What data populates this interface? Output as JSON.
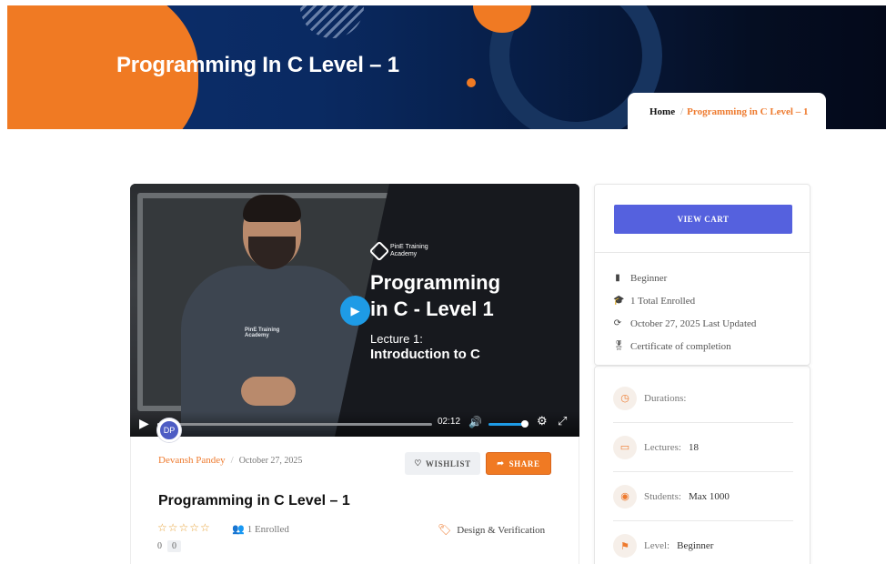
{
  "hero": {
    "title": "Programming In C Level – 1",
    "breadcrumb": {
      "home": "Home",
      "separator": "/",
      "current": "Programming in C Level – 1"
    }
  },
  "video": {
    "brand": "PinE Training\nAcademy",
    "hoodie_text": "PinE Training\nAcademy",
    "slide_title": "Programming\nin C - Level 1",
    "lecture_label": "Lecture 1:",
    "lecture_title": "Introduction to C",
    "time": "02:12",
    "progress": 0.05,
    "volume": 0.9
  },
  "course": {
    "avatar_initials": "DP",
    "author": "Devansh Pandey",
    "separator": "/",
    "date": "October 27, 2025",
    "wishlist_label": "WISHLIST",
    "share_label": "SHARE",
    "title": "Programming in C Level – 1",
    "stars": "☆☆☆☆☆",
    "enrolled": "1 Enrolled",
    "category": "Design & Verification",
    "rating_avg": "0",
    "rating_count": "0"
  },
  "sidebar": {
    "cart_label": "VIEW CART",
    "info": [
      {
        "icon": "level-icon",
        "text": "Beginner"
      },
      {
        "icon": "graduation-cap-icon",
        "text": "1 Total Enrolled"
      },
      {
        "icon": "refresh-icon",
        "text": "October 27, 2025 Last Updated"
      },
      {
        "icon": "certificate-icon",
        "text": "Certificate of completion"
      }
    ],
    "stats": [
      {
        "icon": "clock-icon",
        "label": "Durations:",
        "value": ""
      },
      {
        "icon": "folder-icon",
        "label": "Lectures:",
        "value": "18"
      },
      {
        "icon": "students-icon",
        "label": "Students:",
        "value": "Max 1000"
      },
      {
        "icon": "flag-icon",
        "label": "Level:",
        "value": "Beginner"
      }
    ]
  },
  "colors": {
    "accent": "#f07a23",
    "primary": "#5561de",
    "video_play": "#1e9be6"
  }
}
